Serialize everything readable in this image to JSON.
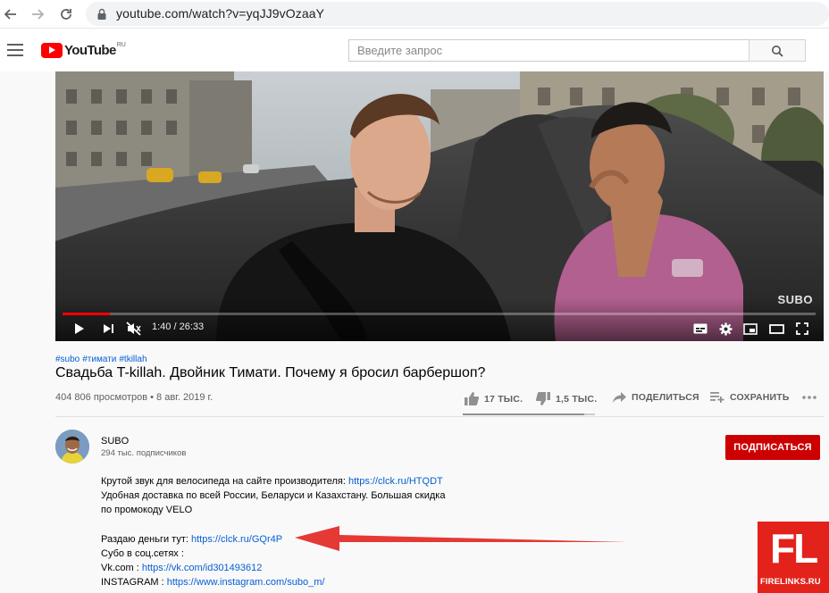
{
  "browser": {
    "url": "youtube.com/watch?v=yqJJ9vOzaaY"
  },
  "header": {
    "logo_text": "YouTube",
    "region": "RU",
    "search_placeholder": "Введите запрос"
  },
  "player": {
    "watermark": "SUBO",
    "time": "1:40 / 26:33",
    "progress": 0.0629
  },
  "video": {
    "hashtags": [
      "#subo",
      "#тимати",
      "#tkillah"
    ],
    "title": "Свадьба T-killah. Двойник Тимати. Почему я бросил барбершоп?",
    "views": "404 806 просмотров",
    "date": "8 авг. 2019 г.",
    "likes": "17 ТЫС.",
    "dislikes": "1,5 ТЫС.",
    "share_label": "ПОДЕЛИТЬСЯ",
    "save_label": "СОХРАНИТЬ",
    "like_ratio": 0.92
  },
  "channel": {
    "name": "SUBO",
    "subscribers": "294 тыс. подписчиков",
    "subscribe_label": "ПОДПИСАТЬСЯ"
  },
  "description": {
    "line1_text": "Крутой звук для велосипеда на сайте производителя: ",
    "line1_link": "https://clck.ru/HTQDT",
    "line2": "Удобная доставка по всей России, Беларуси и Казахстану. Большая скидка",
    "line3": "по промокоду VELO",
    "line4_text": "Раздаю деньги тут: ",
    "line4_link": "https://clck.ru/GQr4P",
    "line5": "Субо в соц.сетях :",
    "line6_text": "Vk.com : ",
    "line6_link": "https://vk.com/id301493612",
    "line7_text": "INSTAGRAM : ",
    "line7_link": "https://www.instagram.com/subo_m/"
  },
  "colors": {
    "accent_red": "#ff0000",
    "subscribe_bg": "#cc0000",
    "link_blue": "#065fd4",
    "arrow_red": "#e53935",
    "fl_logo_bg": "#e3221b"
  },
  "fl_logo": {
    "big": "FL",
    "small": "FIRELINKS.RU"
  }
}
